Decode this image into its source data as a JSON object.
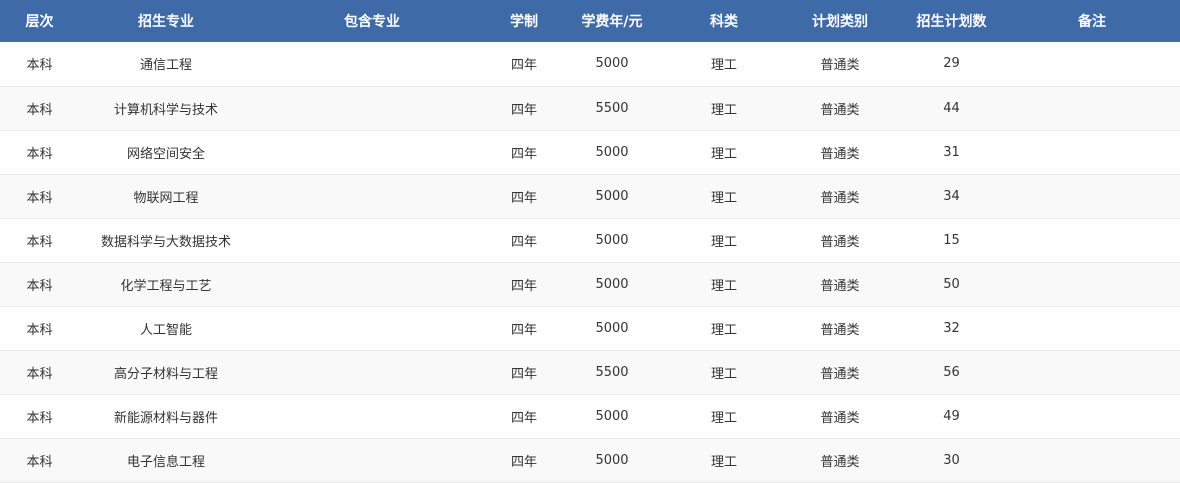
{
  "table": {
    "columns": [
      "层次",
      "招生专业",
      "包含专业",
      "学制",
      "学费年/元",
      "科类",
      "计划类别",
      "招生计划数",
      "备注"
    ],
    "rows": [
      [
        "本科",
        "通信工程",
        "",
        "四年",
        "5000",
        "理工",
        "普通类",
        "29",
        ""
      ],
      [
        "本科",
        "计算机科学与技术",
        "",
        "四年",
        "5500",
        "理工",
        "普通类",
        "44",
        ""
      ],
      [
        "本科",
        "网络空间安全",
        "",
        "四年",
        "5000",
        "理工",
        "普通类",
        "31",
        ""
      ],
      [
        "本科",
        "物联网工程",
        "",
        "四年",
        "5000",
        "理工",
        "普通类",
        "34",
        ""
      ],
      [
        "本科",
        "数据科学与大数据技术",
        "",
        "四年",
        "5000",
        "理工",
        "普通类",
        "15",
        ""
      ],
      [
        "本科",
        "化学工程与工艺",
        "",
        "四年",
        "5000",
        "理工",
        "普通类",
        "50",
        ""
      ],
      [
        "本科",
        "人工智能",
        "",
        "四年",
        "5000",
        "理工",
        "普通类",
        "32",
        ""
      ],
      [
        "本科",
        "高分子材料与工程",
        "",
        "四年",
        "5500",
        "理工",
        "普通类",
        "56",
        ""
      ],
      [
        "本科",
        "新能源材料与器件",
        "",
        "四年",
        "5000",
        "理工",
        "普通类",
        "49",
        ""
      ],
      [
        "本科",
        "电子信息工程",
        "",
        "四年",
        "5000",
        "理工",
        "普通类",
        "30",
        ""
      ]
    ]
  },
  "colors": {
    "header_bg": "#3e6aa8",
    "header_text": "#ffffff",
    "row_alt_bg": "#f9f9f9",
    "body_text": "#333333"
  }
}
